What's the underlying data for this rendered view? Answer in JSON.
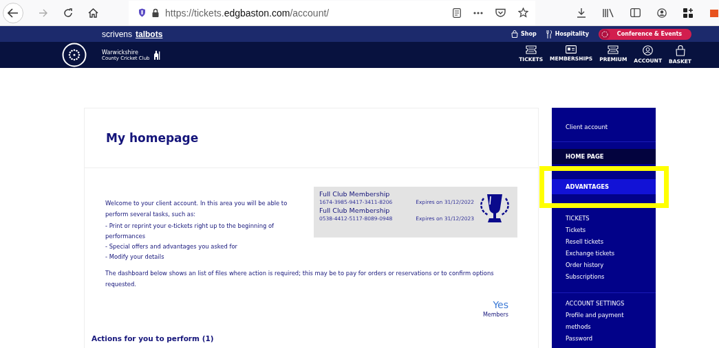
{
  "browser": {
    "url": "https://tickets.**edgbaston.com**/account/",
    "forward_disabled": true
  },
  "top_bar": {
    "sponsors": [
      "scrivens",
      "talbots"
    ],
    "links": [
      {
        "label": "Shop",
        "kind": "bag",
        "highlighted": false
      },
      {
        "label": "Hospitality",
        "kind": "cutlery",
        "highlighted": false
      },
      {
        "label": "Conference & Events",
        "kind": "globe",
        "highlighted": true
      }
    ]
  },
  "header": {
    "club_name": "Warwickshire",
    "club_subtitle": "County Cricket Club",
    "nav": [
      {
        "label": "TICKETS",
        "kind": "ticket"
      },
      {
        "label": "MEMBERSHIPS",
        "kind": "card"
      },
      {
        "label": "PREMIUM",
        "kind": "ticket"
      },
      {
        "label": "ACCOUNT",
        "kind": "person"
      },
      {
        "label": "BASKET",
        "kind": "bag"
      }
    ]
  },
  "page": {
    "title": "My homepage",
    "intro": "Welcome to your client account. In this area you will be able to perform several tasks, such as:",
    "tasks": [
      "- Print or reprint your e-tickets right up to the beginning of performances",
      "- Special offers and advantages you asked for",
      "- Modify your details"
    ],
    "dashboard_note": "The dashboard below shows an list of files where action is required; this may be to pay for orders or reservations or to confirm options requested.",
    "memberships": [
      {
        "name": "Full Club Membership",
        "number": "1674-3985-9417-3411-8206",
        "expiry": "Expires on 31/12/2022"
      },
      {
        "name": "Full Club Membership",
        "number": "0538-4412-5117-8089-0948",
        "expiry": "Expires on 31/12/2023"
      }
    ],
    "member_status": {
      "value": "Yes",
      "label": "Members"
    },
    "actions_heading": "Actions for you to perform (1)"
  },
  "sidebar": {
    "title": "Client account",
    "tabs": [
      {
        "label": "HOME PAGE",
        "selected": true,
        "hovered": false,
        "annotated": false
      },
      {
        "label": "ADVANTAGES",
        "selected": false,
        "hovered": true,
        "annotated": true
      }
    ],
    "groups": [
      {
        "heading": "TICKETS",
        "links": [
          "Tickets",
          "Resell tickets",
          "Exchange tickets",
          "Order history",
          "Subscriptions"
        ]
      },
      {
        "heading": "ACCOUNT SETTINGS",
        "links": [
          "Profile and payment methods",
          "Password"
        ]
      }
    ]
  }
}
